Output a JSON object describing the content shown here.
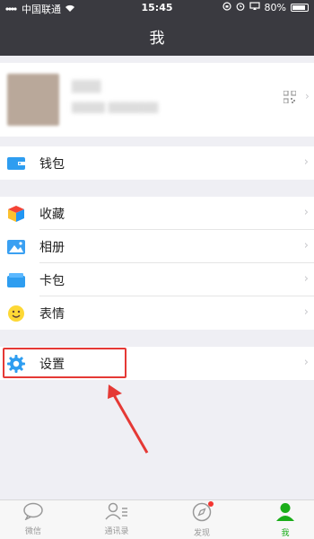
{
  "status_bar": {
    "carrier": "中国联通",
    "time": "15:45",
    "battery": "80%"
  },
  "nav": {
    "title": "我"
  },
  "profile": {
    "name": "",
    "id": ""
  },
  "menu": {
    "wallet": "钱包",
    "favorites": "收藏",
    "album": "相册",
    "cards": "卡包",
    "stickers": "表情",
    "settings": "设置"
  },
  "tabs": [
    {
      "label": "微信",
      "icon": "chat-icon"
    },
    {
      "label": "通讯录",
      "icon": "contacts-icon"
    },
    {
      "label": "发现",
      "icon": "compass-icon"
    },
    {
      "label": "我",
      "icon": "me-icon"
    }
  ],
  "colors": {
    "accent": "#1aad19",
    "highlight": "#e53935",
    "nav_bg": "#3a3a40"
  }
}
